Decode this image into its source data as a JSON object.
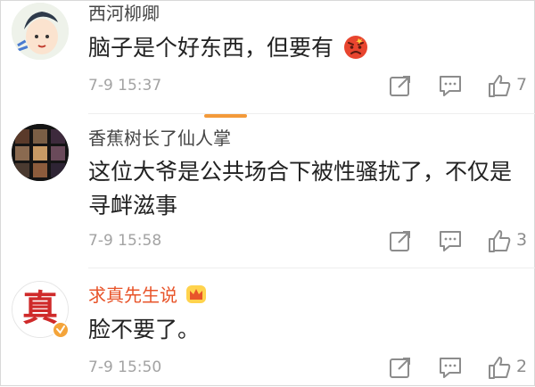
{
  "comments": [
    {
      "username": "西河柳卿",
      "text": "脑子是个好东西，但要有",
      "emoji": "angry-face-icon",
      "time": "7-9 15:37",
      "likes": "7"
    },
    {
      "username": "香蕉树长了仙人掌",
      "text": "这位大爷是公共场合下被性骚扰了，不仅是寻衅滋事",
      "time": "7-9 15:58",
      "likes": "3"
    },
    {
      "username": "求真先生说",
      "badge": "crown-badge-icon",
      "avatar_text": "真",
      "text": "脸不要了。",
      "time": "7-9 15:50",
      "likes": "2"
    }
  ],
  "colors": {
    "vip_name": "#e8542a",
    "accent_bar": "#f39a3a",
    "verified": "#f4a43a"
  }
}
